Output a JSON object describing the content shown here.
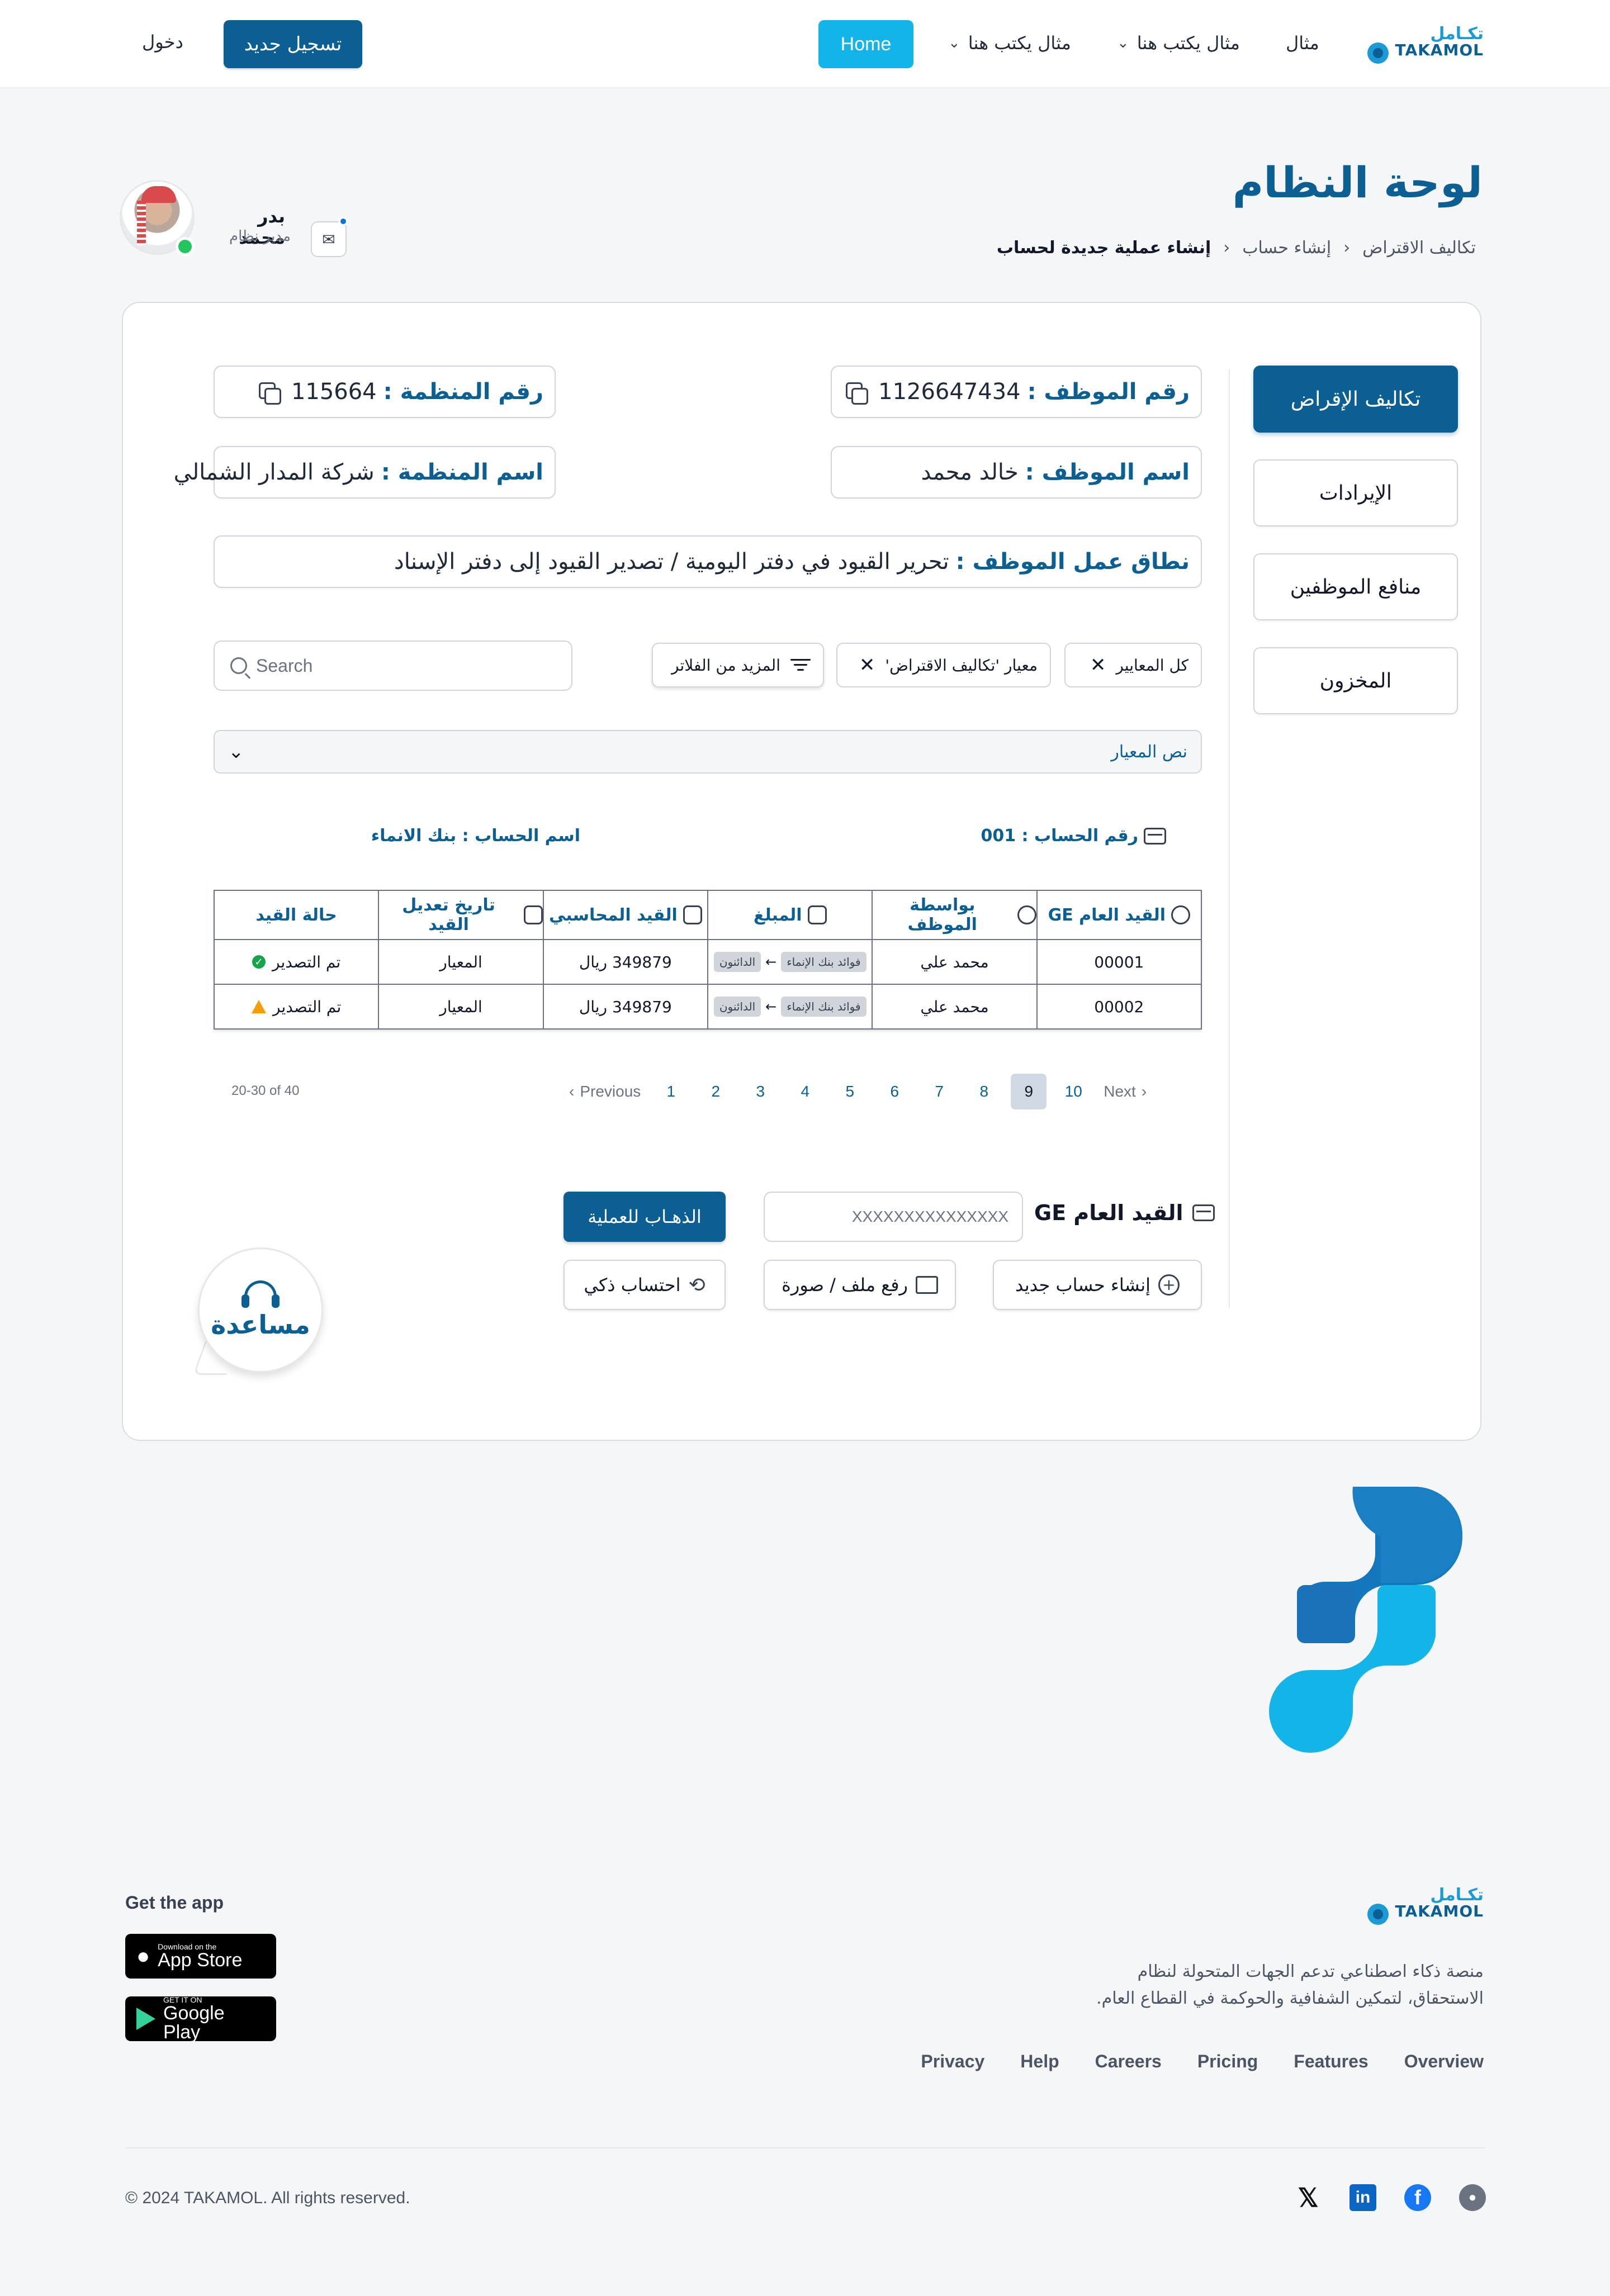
{
  "brand": {
    "name_ar": "تكـامل",
    "name_en": "TAKAMOL"
  },
  "nav": {
    "items": [
      "مثال",
      "مثال يكتب هنا",
      "مثال يكتب هنا"
    ],
    "home": "Home",
    "register": "تسجيل جديد",
    "login": "دخول"
  },
  "page": {
    "title": "لوحة النظام",
    "breadcrumb": [
      "تكاليف الاقتراض",
      "إنشاء حساب",
      "إنشاء عملية جديدة لحساب"
    ]
  },
  "user": {
    "name": "بدر محمد",
    "role": "مدير نظام"
  },
  "sidebar": [
    "تكاليف الإقراض",
    "الإيرادات",
    "منافع الموظفين",
    "المخزون"
  ],
  "info": {
    "employee_no_label": "رقم الموظف :",
    "employee_no": "1126647434",
    "org_no_label": "رقم المنظمة :",
    "org_no": "115664",
    "employee_name_label": "اسم الموظف :",
    "employee_name": "خالد محمد",
    "org_name_label": "اسم المنظمة :",
    "org_name": "شركة المدار الشمالي",
    "scope_label": "نطاق عمل الموظف :",
    "scope": "تحرير القيود في دفتر اليومية / تصدير القيود إلى دفتر الإسناد"
  },
  "filters": {
    "all": "كل المعايير",
    "standard": "معيار 'تكاليف الاقتراض'",
    "more": "المزيد من الفلاتر",
    "search_placeholder": "Search"
  },
  "criteria_text": "نص المعيار",
  "account": {
    "number_label": "رقم الحساب : 001",
    "name_label": "اسم  الحساب : بنك الانماء"
  },
  "table": {
    "headers": [
      "القيد العام GE",
      "بواسطة الموظف",
      "المبلغ",
      "القيد المحاسبي",
      "تاريخ تعديل القيد",
      "حالة القيد"
    ],
    "rows": [
      {
        "ge": "00001",
        "employee": "محمد علي",
        "from": "فوائد بنك الإنماء",
        "to": "الدائنون",
        "amount": "349879 ريال",
        "date": "المعيار",
        "status": "تم التصدير",
        "status_type": "ok"
      },
      {
        "ge": "00002",
        "employee": "محمد علي",
        "from": "فوائد بنك الإنماء",
        "to": "الدائنون",
        "amount": "349879 ريال",
        "date": "المعيار",
        "status": "تم التصدير",
        "status_type": "warning"
      }
    ]
  },
  "pagination": {
    "range": "20-30 of 40",
    "previous": "Previous",
    "next": "Next",
    "pages": [
      "1",
      "2",
      "3",
      "4",
      "5",
      "6",
      "7",
      "8",
      "9",
      "10"
    ],
    "current": "9"
  },
  "form": {
    "ge_label": "القيد العام GE",
    "ge_placeholder": "XXXXXXXXXXXXXXX",
    "go": "الذهـاب للعملية",
    "new_account": "إنشاء حساب جديد",
    "upload": "رفع ملف / صورة",
    "smart_calc": "احتساب ذكي"
  },
  "help": "مساعدة",
  "footer": {
    "description": "منصة ذكاء اصطناعي تدعم الجهات المتحولة لنظام الاستحقاق، لتمكين الشفافية والحوكمة في القطاع العام.",
    "get_app": "Get the app",
    "app_store_small": "Download on the",
    "app_store": "App Store",
    "google_small": "GET IT ON",
    "google": "Google Play",
    "links": [
      "Overview",
      "Features",
      "Pricing",
      "Careers",
      "Help",
      "Privacy"
    ],
    "copyright": "© 2024 TAKAMOL. All rights reserved."
  },
  "colors": {
    "primary": "#0b5f92",
    "accent": "#13b5e8",
    "success": "#16a34a",
    "warning": "#f59e0b"
  }
}
